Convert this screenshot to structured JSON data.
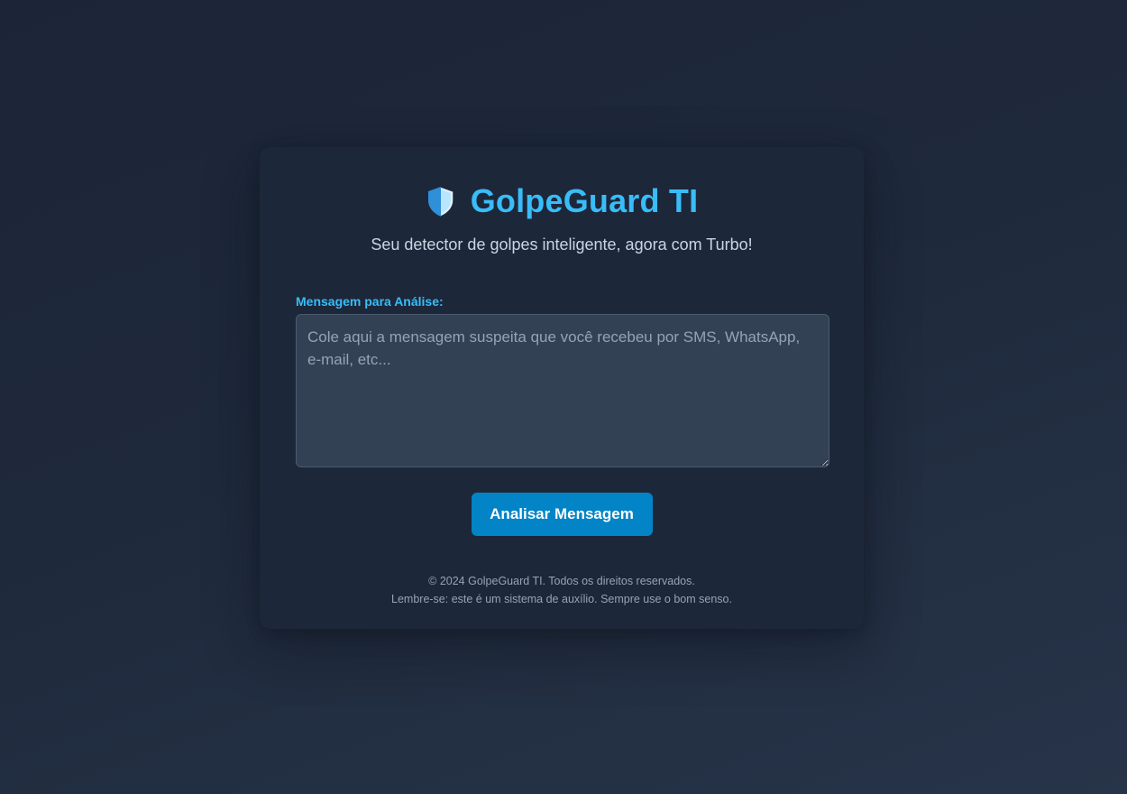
{
  "header": {
    "icon": "shield-icon",
    "title": "GolpeGuard TI",
    "subtitle": "Seu detector de golpes inteligente, agora com Turbo!"
  },
  "form": {
    "label": "Mensagem para Análise:",
    "textarea_value": "",
    "textarea_placeholder": "Cole aqui a mensagem suspeita que você recebeu por SMS, WhatsApp, e-mail, etc...",
    "button_label": "Analisar Mensagem"
  },
  "footer": {
    "copyright": "© 2024 GolpeGuard TI. Todos os direitos reservados.",
    "disclaimer": "Lembre-se: este é um sistema de auxílio. Sempre use o bom senso."
  },
  "colors": {
    "accent": "#38bdf8",
    "button": "#0284c7",
    "card": "#1d273a",
    "input_bg": "#334155"
  }
}
